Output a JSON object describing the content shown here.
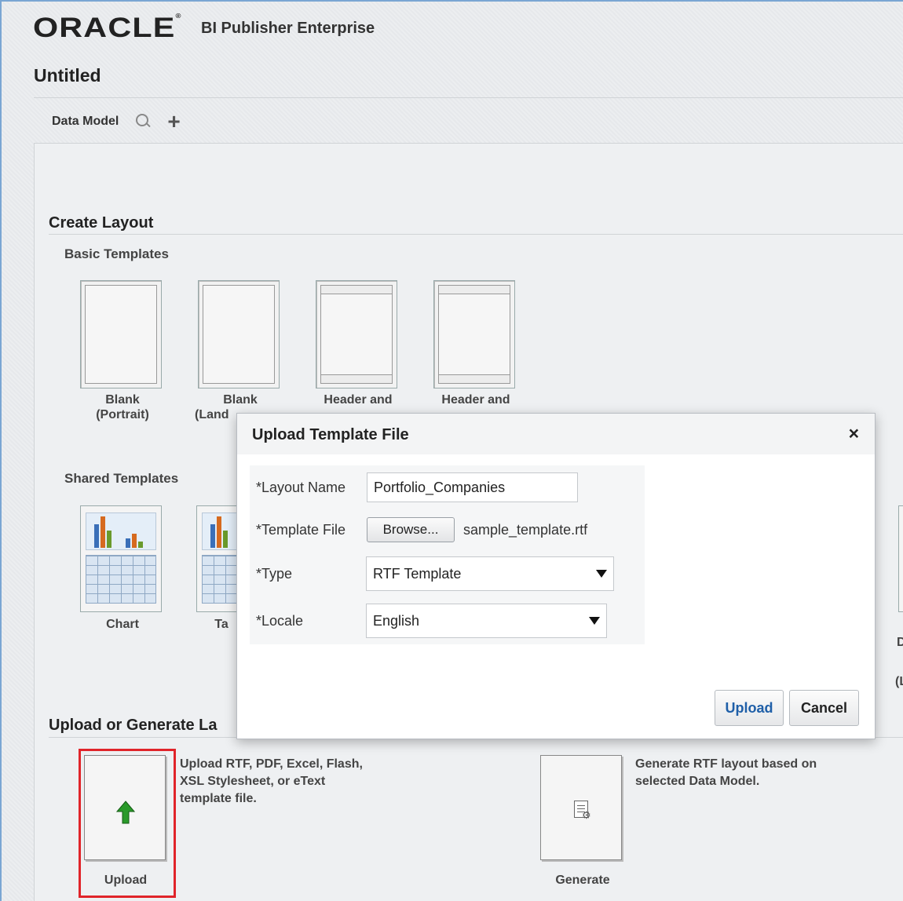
{
  "header": {
    "brand": "ORACLE",
    "product": "BI Publisher Enterprise",
    "page_title": "Untitled"
  },
  "toolbar": {
    "data_model_label": "Data Model",
    "search_icon": "search-icon",
    "add_icon": "plus-icon"
  },
  "create_layout": {
    "title": "Create Layout",
    "basic_templates_title": "Basic Templates",
    "basic_templates": [
      {
        "line1": "Blank",
        "line2": "(Portrait)"
      },
      {
        "line1": "Blank",
        "line2": "(Land"
      },
      {
        "line1": "Header and",
        "line2": ""
      },
      {
        "line1": "Header and",
        "line2": ""
      }
    ],
    "shared_templates_title": "Shared Templates",
    "shared_templates": [
      {
        "label": "Chart"
      },
      {
        "label": "Ta"
      }
    ],
    "right_edge_labels": [
      "D",
      "(L"
    ]
  },
  "upload_section": {
    "title": "Upload or Generate La",
    "upload_label": "Upload",
    "upload_desc_lines": [
      "Upload RTF, PDF, Excel, Flash,",
      "XSL Stylesheet, or eText",
      "template file."
    ],
    "generate_label": "Generate",
    "generate_desc_lines": [
      "Generate RTF layout based on",
      "selected Data Model."
    ]
  },
  "dialog": {
    "title": "Upload Template File",
    "close_glyph": "×",
    "layout_name_label": "*Layout Name",
    "layout_name_value": "Portfolio_Companies",
    "template_file_label": "*Template File",
    "browse_label": "Browse...",
    "file_name": "sample_template.rtf",
    "type_label": "*Type",
    "type_value": "RTF Template",
    "locale_label": "*Locale",
    "locale_value": "English",
    "upload_button": "Upload",
    "cancel_button": "Cancel"
  },
  "colors": {
    "accent_blue": "#1f5fa8",
    "highlight_red": "#e0242a",
    "upload_arrow_green": "#2a9a2a"
  }
}
